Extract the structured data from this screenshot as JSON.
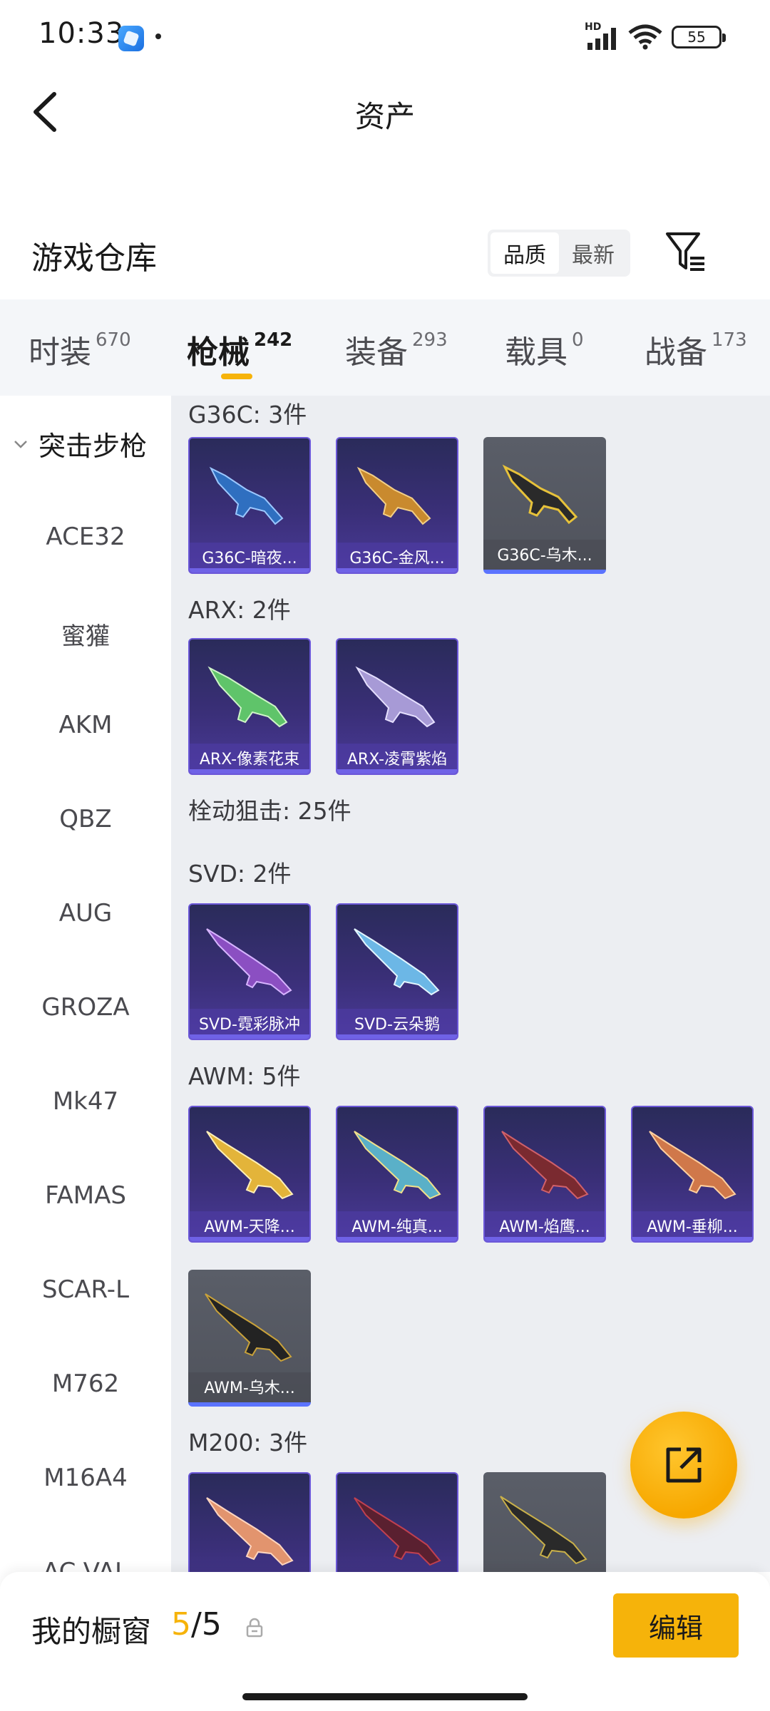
{
  "status_bar": {
    "time": "10:33",
    "network": "HD",
    "battery": "55"
  },
  "header": {
    "title": "资产",
    "back_icon": "chevron-left-icon"
  },
  "warehouse": {
    "title": "游戏仓库",
    "sort_options": [
      "品质",
      "最新"
    ],
    "active_sort": "品质",
    "filter_icon": "filter-icon"
  },
  "tabs": [
    {
      "label": "时装",
      "count": "670"
    },
    {
      "label": "枪械",
      "count": "242"
    },
    {
      "label": "装备",
      "count": "293"
    },
    {
      "label": "载具",
      "count": "0"
    },
    {
      "label": "战备",
      "count": "173"
    }
  ],
  "active_tab": "枪械",
  "sidebar": {
    "group": "突击步枪",
    "items": [
      "ACE32",
      "蜜獾",
      "AKM",
      "QBZ",
      "AUG",
      "GROZA",
      "Mk47",
      "FAMAS",
      "SCAR-L",
      "M762",
      "M16A4",
      "AC-VAL"
    ]
  },
  "sections": {
    "g36c": {
      "label": "G36C: 3件",
      "items": [
        "G36C-暗夜...",
        "G36C-金风...",
        "G36C-乌木..."
      ]
    },
    "arx": {
      "label": "ARX: 2件",
      "items": [
        "ARX-像素花束",
        "ARX-凌霄紫焰"
      ]
    },
    "bolt": {
      "label": "栓动狙击: 25件"
    },
    "svd": {
      "label": "SVD: 2件",
      "items": [
        "SVD-霓彩脉冲",
        "SVD-云朵鹅"
      ]
    },
    "awm": {
      "label": "AWM: 5件",
      "items": [
        "AWM-天降...",
        "AWM-纯真...",
        "AWM-焰鹰...",
        "AWM-垂柳...",
        "AWM-乌木..."
      ]
    },
    "m200": {
      "label": "M200: 3件"
    }
  },
  "bottom_bar": {
    "title": "我的橱窗",
    "current": "5",
    "separator": "/",
    "max": "5",
    "edit_label": "编辑"
  },
  "colors": {
    "accent": "#f6b30a",
    "card_purple": "#3a2f78",
    "card_gray": "#55585f"
  }
}
